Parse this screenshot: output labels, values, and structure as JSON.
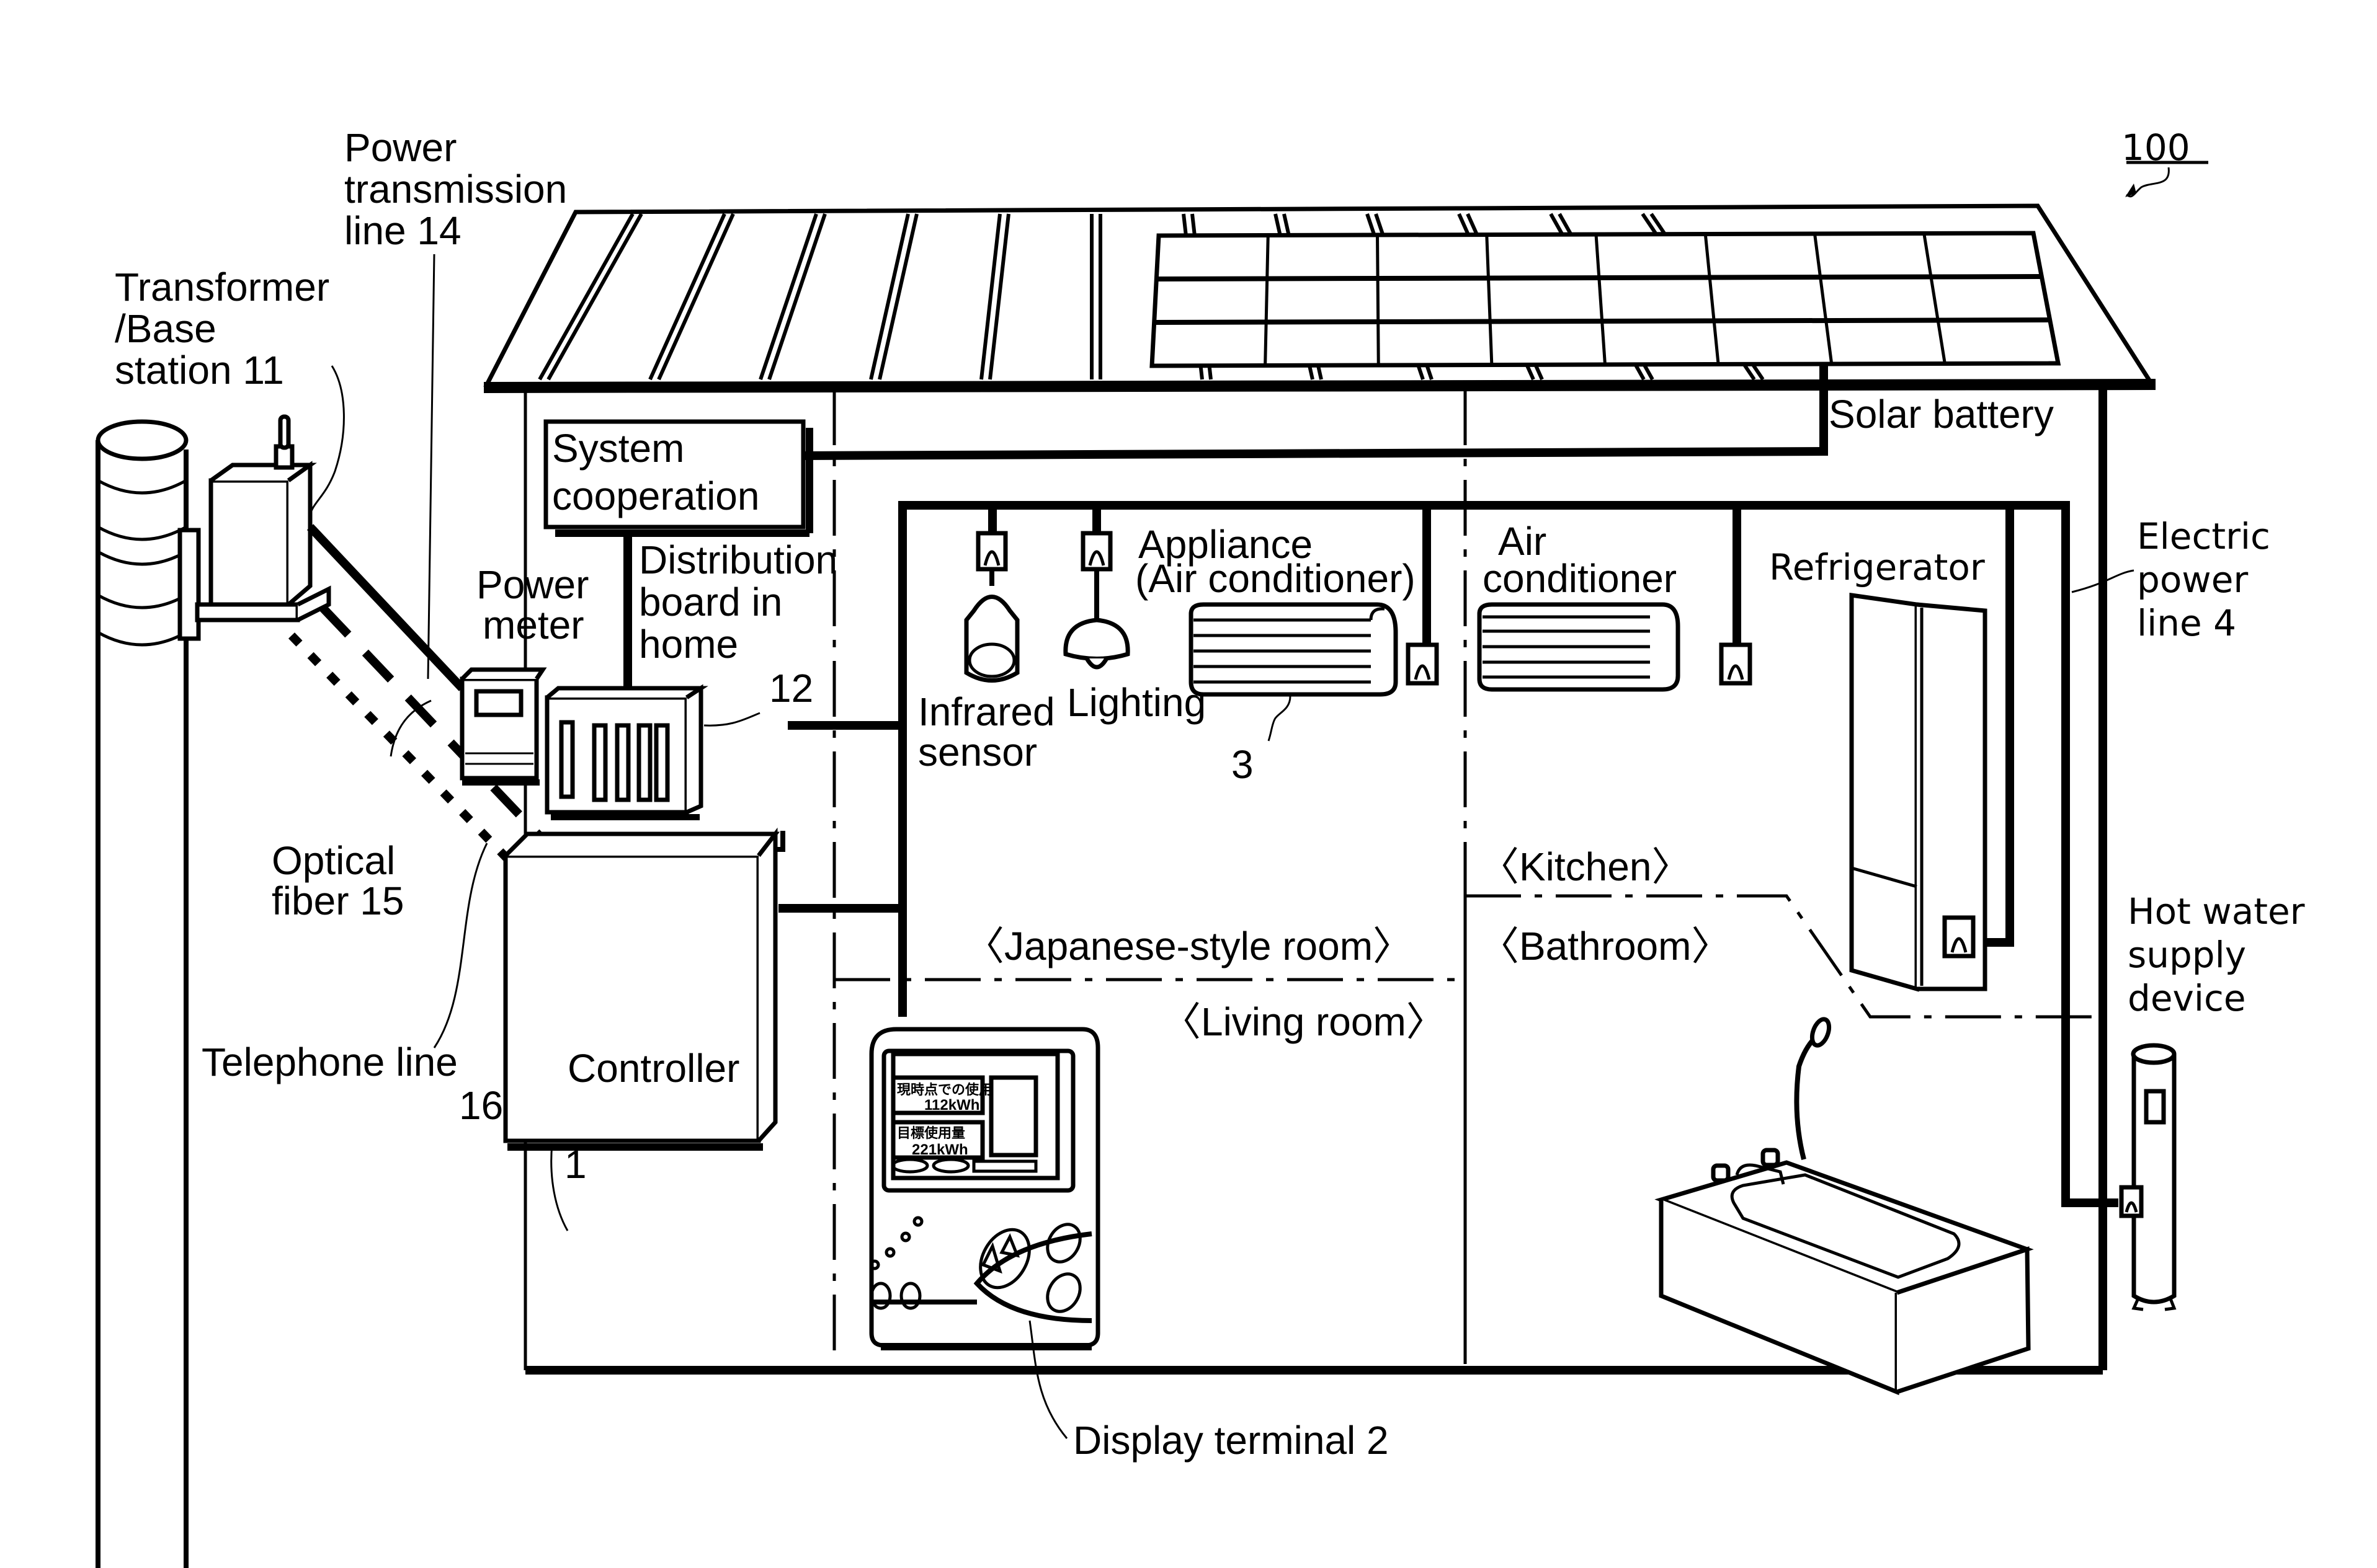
{
  "figure": {
    "reference_number": "100",
    "labels": {
      "power_transmission_line": [
        "Power",
        "transmission",
        "line 14"
      ],
      "transformer_base_station": [
        "Transformer",
        "/Base",
        "station 11"
      ],
      "system_cooperation": [
        "System",
        "cooperation"
      ],
      "power_meter": [
        "Power",
        "meter"
      ],
      "distribution_board": [
        "Distribution",
        "board in",
        "home"
      ],
      "distribution_board_ref": "12",
      "optical_fiber": [
        "Optical",
        "fiber 15"
      ],
      "telephone_line": [
        "Telephone line",
        "16"
      ],
      "controller": "Controller",
      "controller_ref": "1",
      "solar_battery": "Solar battery",
      "appliance": [
        "Appliance",
        "(Air conditioner)"
      ],
      "appliance_ref": "3",
      "infrared_sensor": [
        "Infrared",
        "sensor"
      ],
      "lighting": "Lighting",
      "air_conditioner": [
        "Air",
        "conditioner"
      ],
      "refrigerator": "Refrigerator",
      "electric_power_line": [
        "Electric",
        "power",
        "line 4"
      ],
      "hot_water_supply": [
        "Hot water",
        "supply",
        "device"
      ],
      "display_terminal": "Display terminal  2"
    },
    "rooms": {
      "japanese_style_room": "〈Japanese-style room〉",
      "living_room": "〈Living room〉",
      "kitchen": "〈Kitchen〉",
      "bathroom": "〈Bathroom〉"
    },
    "display_screen": {
      "current_usage_label": "現時点での使用量",
      "current_usage_value": "112kWh",
      "target_usage_label": "目標使用量",
      "target_usage_value": "221kWh"
    },
    "solar_panel_grid": {
      "columns": 8,
      "rows": 3
    }
  }
}
